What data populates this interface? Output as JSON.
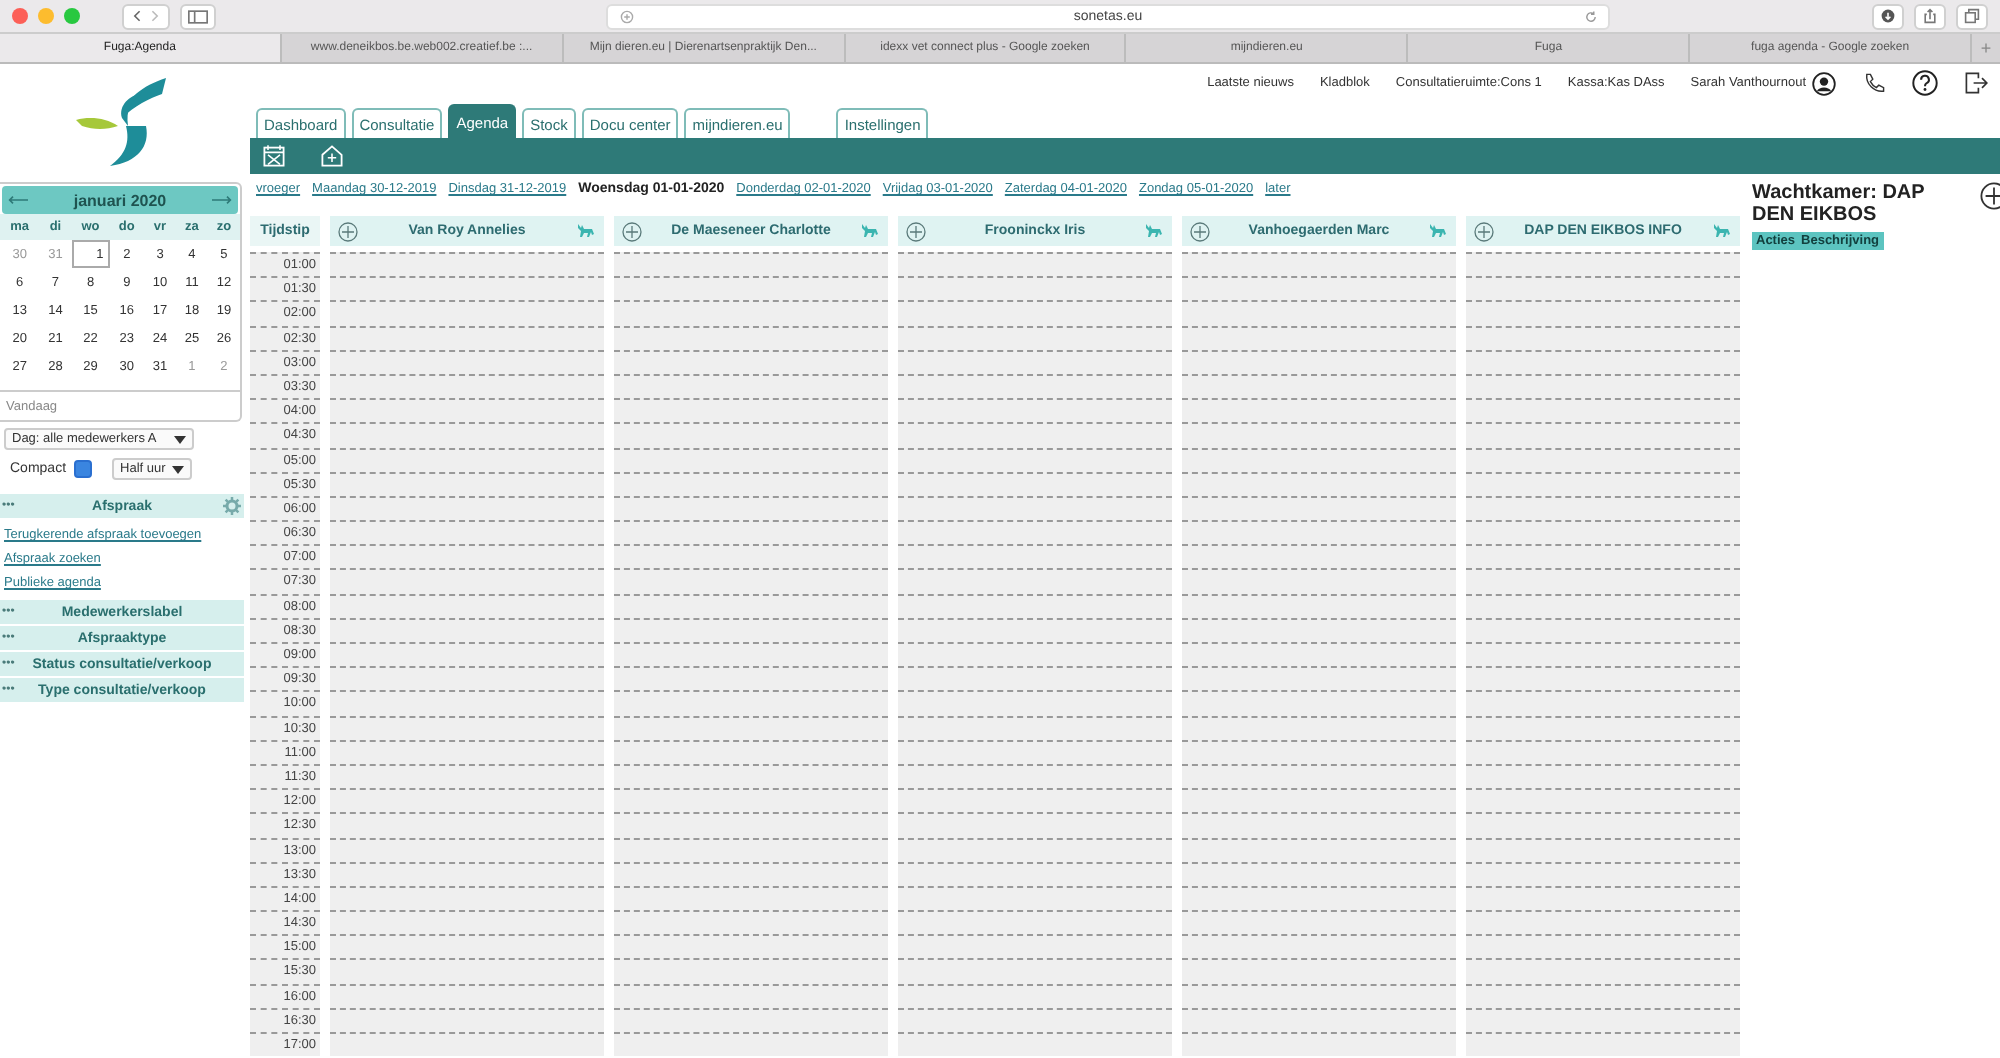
{
  "browser": {
    "address": "sonetas.eu",
    "tabs": [
      {
        "label": "Fuga:Agenda",
        "selected": true
      },
      {
        "label": "www.deneikbos.be.web002.creatief.be :...",
        "selected": false
      },
      {
        "label": "Mijn dieren.eu | Dierenartsenpraktijk Den...",
        "selected": false
      },
      {
        "label": "idexx vet connect plus - Google zoeken",
        "selected": false
      },
      {
        "label": "mijndieren.eu",
        "selected": false
      },
      {
        "label": "Fuga",
        "selected": false
      },
      {
        "label": "fuga agenda - Google zoeken",
        "selected": false
      }
    ],
    "new_tab": "+"
  },
  "header": {
    "links": [
      "Laatste nieuws",
      "Kladblok",
      "Consultatieruimte:Cons 1",
      "Kassa:Kas DAss",
      "Sarah Vanthournout"
    ]
  },
  "app_tabs": [
    {
      "label": "Dashboard",
      "selected": false
    },
    {
      "label": "Consultatie",
      "selected": false
    },
    {
      "label": "Agenda",
      "selected": true
    },
    {
      "label": "Stock",
      "selected": false
    },
    {
      "label": "Docu center",
      "selected": false
    },
    {
      "label": "mijndieren.eu",
      "selected": false
    },
    {
      "label": "Instellingen",
      "selected": false,
      "kind": "separate"
    }
  ],
  "calendar": {
    "month": "januari 2020",
    "weekdays": [
      "ma",
      "di",
      "wo",
      "do",
      "vr",
      "za",
      "zo"
    ],
    "weeks": [
      [
        {
          "d": "30",
          "other_month": true,
          "selected": false
        },
        {
          "d": "31",
          "other_month": true,
          "selected": false
        },
        {
          "d": "1",
          "other_month": false,
          "selected": true
        },
        {
          "d": "2",
          "other_month": false,
          "selected": false
        },
        {
          "d": "3",
          "other_month": false,
          "selected": false
        },
        {
          "d": "4",
          "other_month": false,
          "selected": false
        },
        {
          "d": "5",
          "other_month": false,
          "selected": false
        }
      ],
      [
        {
          "d": "6",
          "other_month": false,
          "selected": false
        },
        {
          "d": "7",
          "other_month": false,
          "selected": false
        },
        {
          "d": "8",
          "other_month": false,
          "selected": false
        },
        {
          "d": "9",
          "other_month": false,
          "selected": false
        },
        {
          "d": "10",
          "other_month": false,
          "selected": false
        },
        {
          "d": "11",
          "other_month": false,
          "selected": false
        },
        {
          "d": "12",
          "other_month": false,
          "selected": false
        }
      ],
      [
        {
          "d": "13",
          "other_month": false,
          "selected": false
        },
        {
          "d": "14",
          "other_month": false,
          "selected": false
        },
        {
          "d": "15",
          "other_month": false,
          "selected": false
        },
        {
          "d": "16",
          "other_month": false,
          "selected": false
        },
        {
          "d": "17",
          "other_month": false,
          "selected": false
        },
        {
          "d": "18",
          "other_month": false,
          "selected": false
        },
        {
          "d": "19",
          "other_month": false,
          "selected": false
        }
      ],
      [
        {
          "d": "20",
          "other_month": false,
          "selected": false
        },
        {
          "d": "21",
          "other_month": false,
          "selected": false
        },
        {
          "d": "22",
          "other_month": false,
          "selected": false
        },
        {
          "d": "23",
          "other_month": false,
          "selected": false
        },
        {
          "d": "24",
          "other_month": false,
          "selected": false
        },
        {
          "d": "25",
          "other_month": false,
          "selected": false
        },
        {
          "d": "26",
          "other_month": false,
          "selected": false
        }
      ],
      [
        {
          "d": "27",
          "other_month": false,
          "selected": false
        },
        {
          "d": "28",
          "other_month": false,
          "selected": false
        },
        {
          "d": "29",
          "other_month": false,
          "selected": false
        },
        {
          "d": "30",
          "other_month": false,
          "selected": false
        },
        {
          "d": "31",
          "other_month": false,
          "selected": false
        },
        {
          "d": "1",
          "other_month": true,
          "selected": false
        },
        {
          "d": "2",
          "other_month": true,
          "selected": false
        }
      ]
    ],
    "today": "Vandaag"
  },
  "filters": {
    "staff_select": "Dag: alle medewerkers A",
    "compact": {
      "label": "Compact",
      "checked": true
    },
    "interval_select": "Half uur"
  },
  "sections": [
    {
      "title": "Afspraak",
      "more": "•••",
      "settings": true,
      "links": [
        "Terugkerende afspraak toevoegen",
        "Afspraak zoeken",
        "Publieke agenda"
      ]
    },
    {
      "title": "Medewerkerslabel",
      "more": "•••",
      "settings": false
    },
    {
      "title": "Afspraaktype",
      "more": "•••",
      "settings": false
    },
    {
      "title": "Status consultatie/verkoop",
      "more": "•••",
      "settings": false
    },
    {
      "title": "Type consultatie/verkoop",
      "more": "•••",
      "settings": false
    }
  ],
  "day_nav": [
    {
      "label": "vroeger",
      "selected": false
    },
    {
      "label": "Maandag 30-12-2019",
      "selected": false
    },
    {
      "label": "Dinsdag 31-12-2019",
      "selected": false
    },
    {
      "label": "Woensdag 01-01-2020",
      "selected": true
    },
    {
      "label": "Donderdag 02-01-2020",
      "selected": false
    },
    {
      "label": "Vrijdag 03-01-2020",
      "selected": false
    },
    {
      "label": "Zaterdag 04-01-2020",
      "selected": false
    },
    {
      "label": "Zondag 05-01-2020",
      "selected": false
    },
    {
      "label": "later",
      "selected": false
    }
  ],
  "agenda": {
    "time_header": "Tijdstip",
    "staff": [
      "Van Roy Annelies",
      "De Maeseneer Charlotte",
      "Frooninckx Iris",
      "Vanhoegaerden Marc",
      "DAP DEN EIKBOS INFO"
    ],
    "times": [
      "01:00",
      "01:30",
      "02:00",
      "02:30",
      "03:00",
      "03:30",
      "04:00",
      "04:30",
      "05:00",
      "05:30",
      "06:00",
      "06:30",
      "07:00",
      "07:30",
      "08:00",
      "08:30",
      "09:00",
      "09:30",
      "10:00",
      "10:30",
      "11:00",
      "11:30",
      "12:00",
      "12:30",
      "13:00",
      "13:30",
      "14:00",
      "14:30",
      "15:00",
      "15:30",
      "16:00",
      "16:30",
      "17:00"
    ]
  },
  "waiting_room": {
    "title": "Wachtkamer: DAP DEN EIKBOS",
    "columns": [
      "Acties",
      "Beschrijving"
    ]
  }
}
